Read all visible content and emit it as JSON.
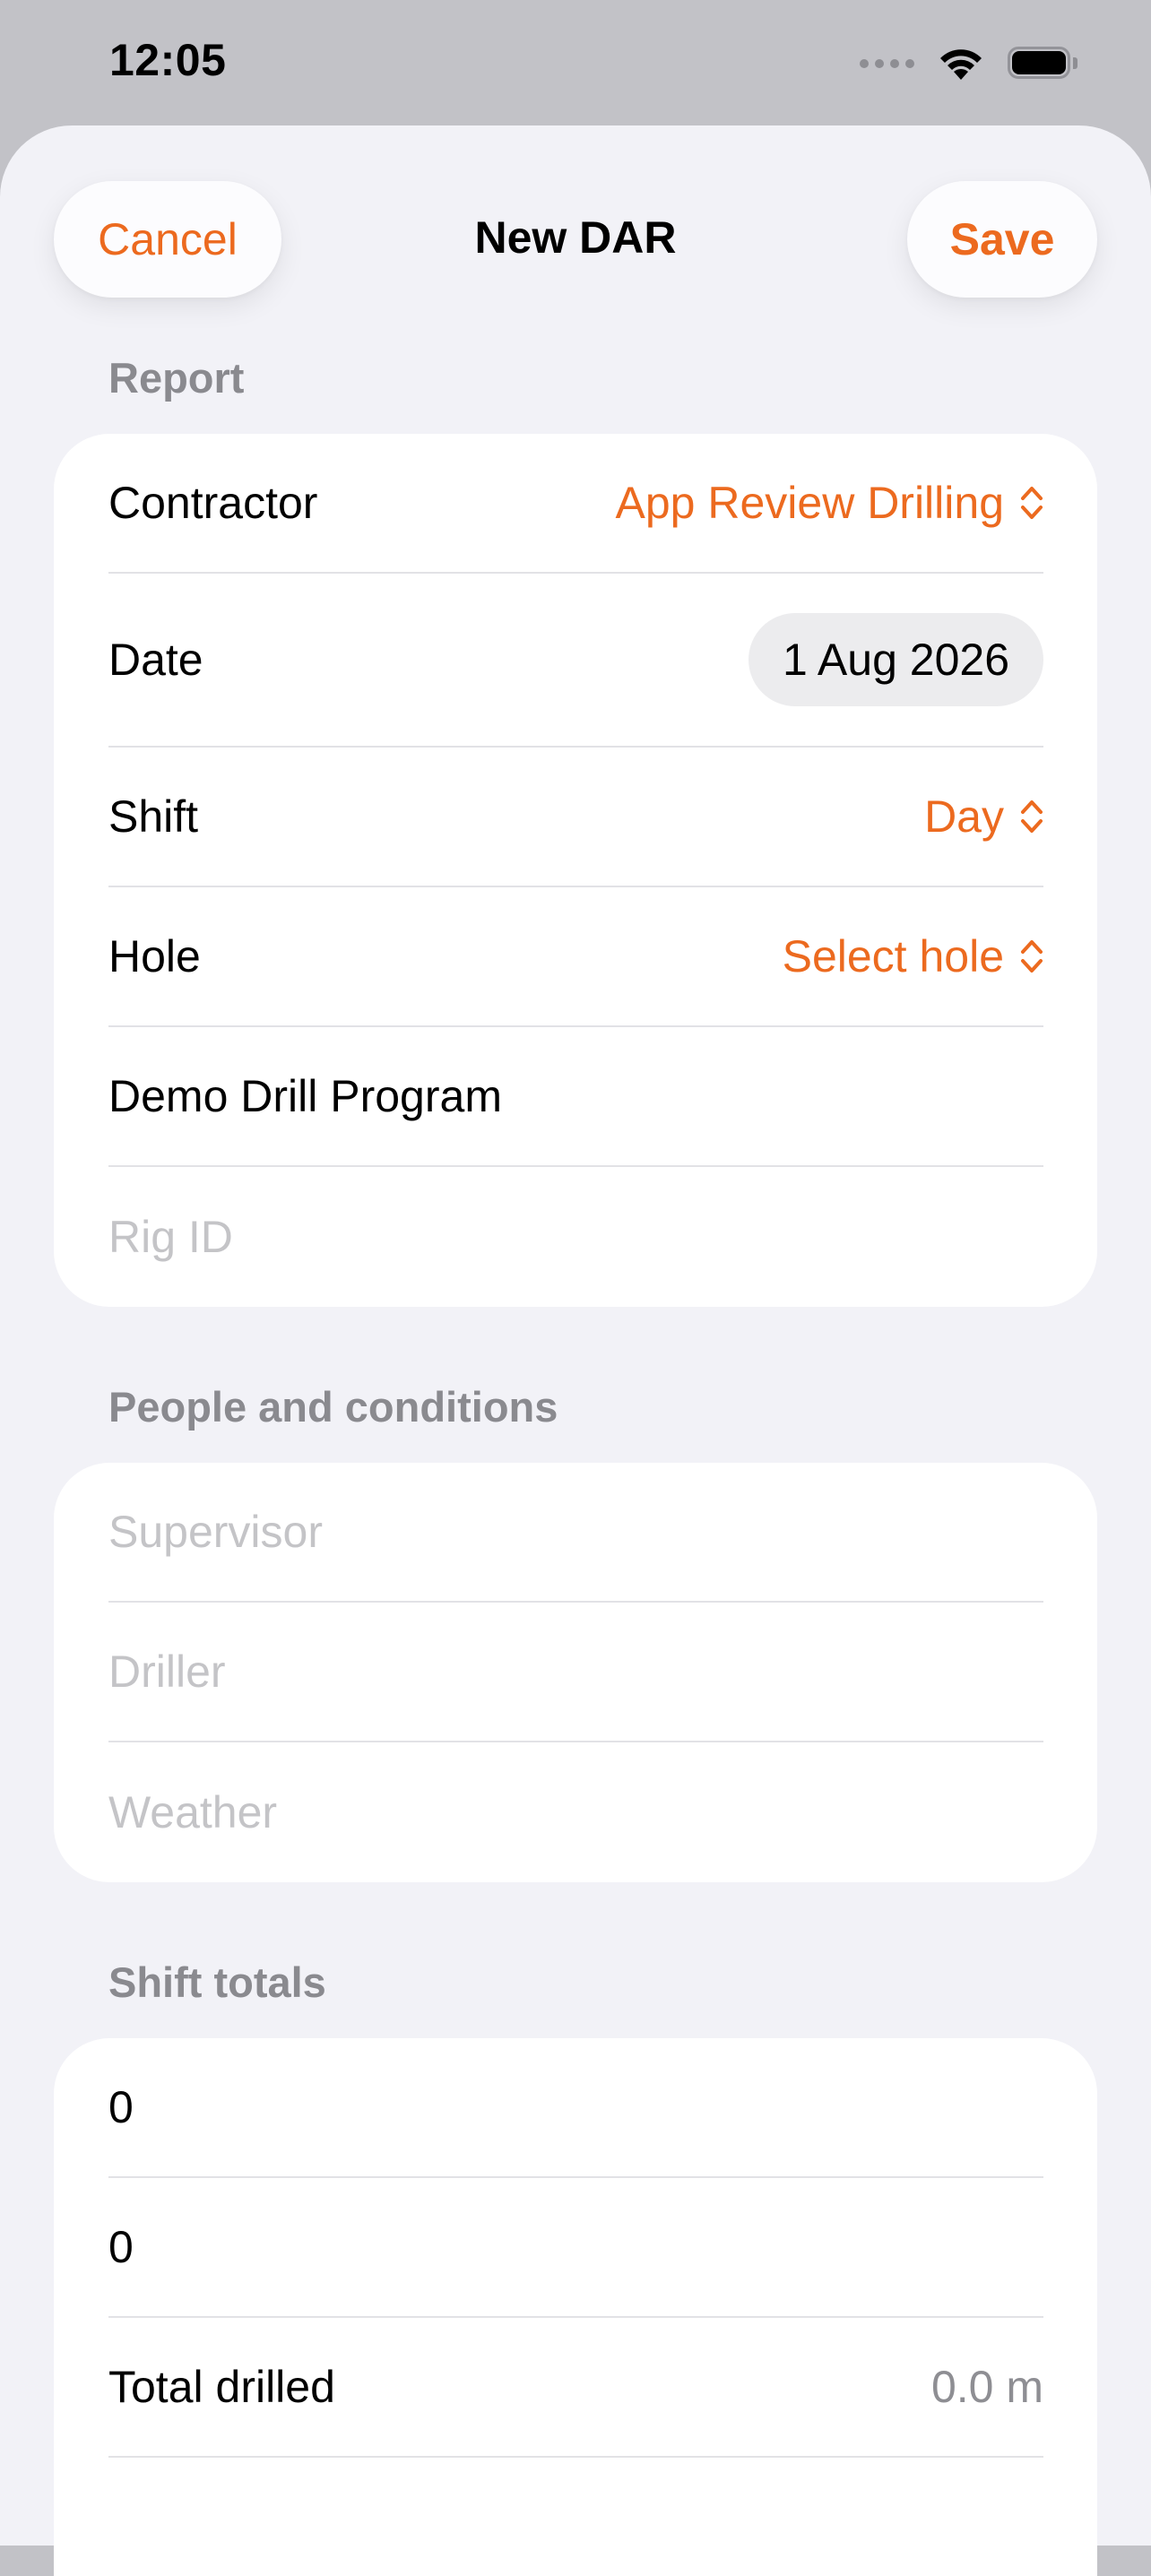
{
  "status_bar": {
    "time": "12:05"
  },
  "nav": {
    "cancel_label": "Cancel",
    "title": "New DAR",
    "save_label": "Save"
  },
  "report": {
    "header": "Report",
    "contractor_label": "Contractor",
    "contractor_value": "App Review Drilling",
    "date_label": "Date",
    "date_value": "1 Aug 2026",
    "shift_label": "Shift",
    "shift_value": "Day",
    "hole_label": "Hole",
    "hole_value": "Select hole",
    "program_value": "Demo Drill Program",
    "rig_placeholder": "Rig ID"
  },
  "people": {
    "header": "People and conditions",
    "supervisor_placeholder": "Supervisor",
    "driller_placeholder": "Driller",
    "weather_placeholder": "Weather"
  },
  "totals": {
    "header": "Shift totals",
    "field_1_value": "0",
    "field_2_value": "0",
    "total_label": "Total drilled",
    "total_value": "0.0 m"
  },
  "colors": {
    "accent": "#ec6a1f",
    "background": "#f2f2f7",
    "secondary_text": "#8a8a8f"
  },
  "icons": [
    "signal-icon",
    "wifi-icon",
    "battery-icon",
    "up-down-chevron-icon"
  ]
}
